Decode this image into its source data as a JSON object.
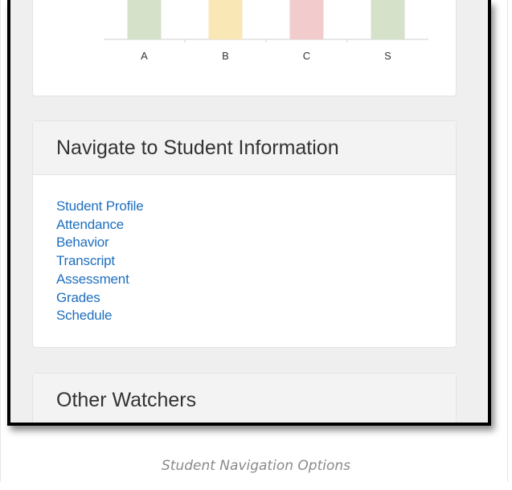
{
  "chart_data": {
    "type": "bar",
    "categories": [
      "A",
      "B",
      "C",
      "S"
    ],
    "bar_colors": [
      "#d5e2c9",
      "#fae7b6",
      "#f2cccc",
      "#d5e2c9"
    ]
  },
  "nav_card": {
    "title": "Navigate to Student Information",
    "links": [
      "Student Profile",
      "Attendance",
      "Behavior",
      "Transcript",
      "Assessment",
      "Grades",
      "Schedule"
    ]
  },
  "watchers_card": {
    "title": "Other Watchers"
  },
  "caption": "Student Navigation Options",
  "colors": {
    "link": "#1f6fbf",
    "page_background": "#efefef",
    "card_header": "#f3f3f3"
  }
}
